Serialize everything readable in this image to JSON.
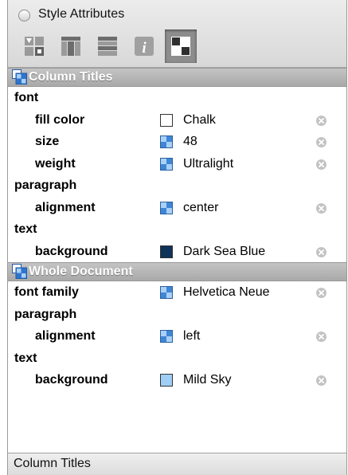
{
  "window": {
    "title": "Style Attributes"
  },
  "toolbar": {
    "buttons": [
      {
        "icon": "cell-layout-icon",
        "selected": false
      },
      {
        "icon": "columns-icon",
        "selected": false
      },
      {
        "icon": "rows-icon",
        "selected": false
      },
      {
        "icon": "info-icon",
        "selected": false
      },
      {
        "icon": "grid-style-icon",
        "selected": true
      }
    ]
  },
  "sections": [
    {
      "title": "Column Titles",
      "rows": [
        {
          "label": "font",
          "level": 0
        },
        {
          "label": "fill color",
          "level": 1,
          "swatch": "color",
          "color": "#ffffff",
          "value": "Chalk",
          "removable": true
        },
        {
          "label": "size",
          "level": 1,
          "swatch": "inherit",
          "value": "48",
          "removable": true
        },
        {
          "label": "weight",
          "level": 1,
          "swatch": "inherit",
          "value": "Ultralight",
          "removable": true
        },
        {
          "label": "paragraph",
          "level": 0
        },
        {
          "label": "alignment",
          "level": 1,
          "swatch": "inherit",
          "value": "center",
          "removable": true
        },
        {
          "label": "text",
          "level": 0
        },
        {
          "label": "background",
          "level": 1,
          "swatch": "color",
          "color": "#0f3258",
          "value": "Dark Sea Blue",
          "removable": true
        }
      ]
    },
    {
      "title": "Whole Document",
      "rows": [
        {
          "label": "font family",
          "level": 0,
          "swatch": "inherit",
          "value": "Helvetica Neue",
          "removable": true
        },
        {
          "label": "paragraph",
          "level": 0
        },
        {
          "label": "alignment",
          "level": 1,
          "swatch": "inherit",
          "value": "left",
          "removable": true
        },
        {
          "label": "text",
          "level": 0
        },
        {
          "label": "background",
          "level": 1,
          "swatch": "color",
          "color": "#9fcff6",
          "value": "Mild Sky",
          "removable": true
        }
      ]
    }
  ],
  "status": {
    "text": "Column Titles"
  },
  "colors": {
    "section_header": "#b3b3b3",
    "inherit_swatch": "#3f86d6",
    "toolbar_selected": "#8d8d8d"
  }
}
